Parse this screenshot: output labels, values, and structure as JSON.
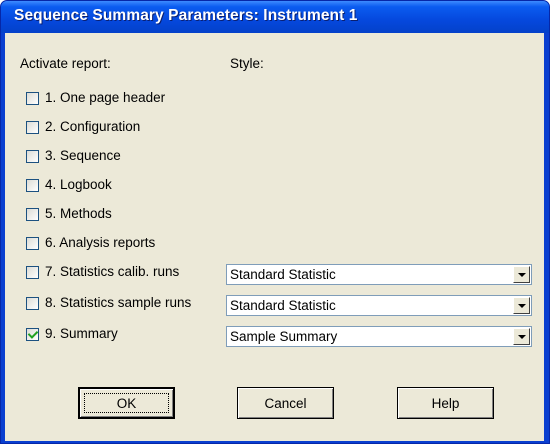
{
  "window": {
    "title": "Sequence Summary Parameters: Instrument 1"
  },
  "headers": {
    "activate": "Activate report:",
    "style": "Style:"
  },
  "reports": [
    {
      "label": "1. One page header",
      "checked": false
    },
    {
      "label": "2. Configuration",
      "checked": false
    },
    {
      "label": "3. Sequence",
      "checked": false
    },
    {
      "label": "4. Logbook",
      "checked": false
    },
    {
      "label": "5. Methods",
      "checked": false
    },
    {
      "label": "6. Analysis reports",
      "checked": false
    },
    {
      "label": "7. Statistics calib. runs",
      "checked": false,
      "style": "Standard Statistic"
    },
    {
      "label": "8. Statistics sample runs",
      "checked": false,
      "style": "Standard Statistic"
    },
    {
      "label": "9. Summary",
      "checked": true,
      "style": "Sample Summary"
    }
  ],
  "buttons": {
    "ok": "OK",
    "cancel": "Cancel",
    "help": "Help"
  }
}
